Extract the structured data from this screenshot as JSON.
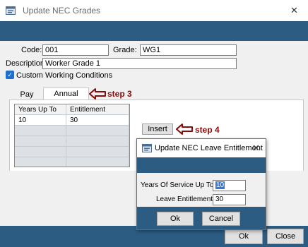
{
  "window": {
    "title": "Update NEC Grades",
    "close_icon": "close-icon"
  },
  "form": {
    "code_label": "Code:",
    "code_value": "001",
    "grade_label": "Grade:",
    "grade_value": "WG1",
    "description_label": "Description:",
    "description_value": "Worker Grade 1",
    "custom_label": "Custom Working Conditions",
    "custom_checked": true
  },
  "tabs": [
    {
      "label": "Pay Rates",
      "active": false
    },
    {
      "label": "Annual Leave",
      "active": true
    }
  ],
  "grid": {
    "headers": [
      "Years Up To",
      "Entitlement"
    ],
    "rows": [
      [
        "10",
        "30"
      ]
    ]
  },
  "buttons": {
    "insert": "Insert",
    "ok": "Ok",
    "close": "Close"
  },
  "annotations": {
    "step3": "step 3",
    "step4": "step 4",
    "color": "#8b0b0b"
  },
  "dialog": {
    "title": "Update NEC Leave Entitlement",
    "years_label": "Years Of Service Up To:",
    "years_value": "10",
    "leave_label": "Leave Entitlement:",
    "leave_value": "30",
    "ok": "Ok",
    "cancel": "Cancel"
  },
  "colors": {
    "band": "#2c5c82",
    "accent": "#1e6fd0"
  }
}
